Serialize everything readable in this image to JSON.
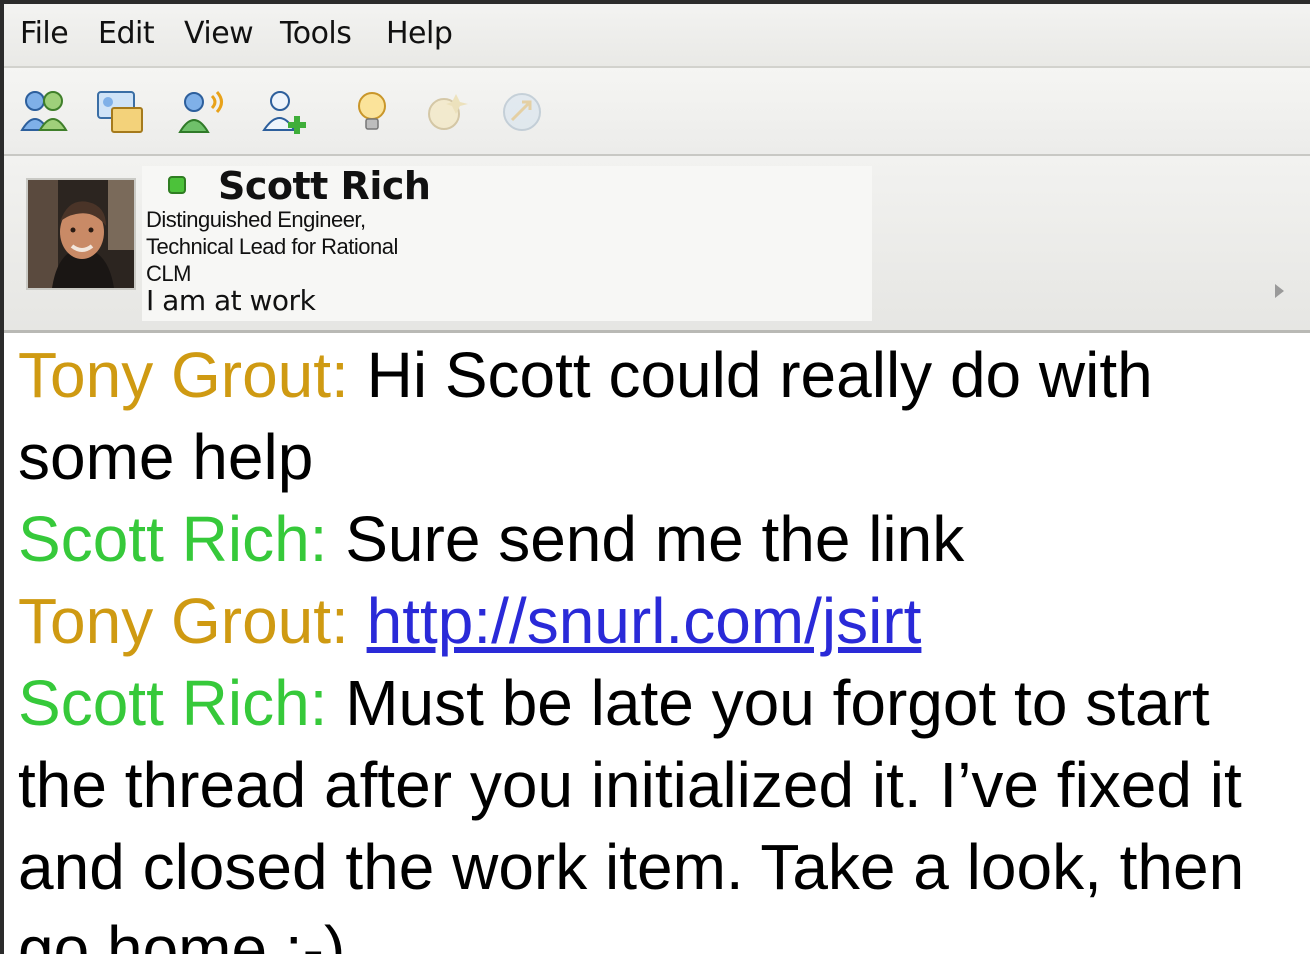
{
  "menubar": {
    "items": [
      "File",
      "Edit",
      "View",
      "Tools",
      "Help"
    ]
  },
  "toolbar": {
    "icons": [
      {
        "name": "contacts-icon"
      },
      {
        "name": "meeting-icon"
      },
      {
        "name": "call-icon"
      },
      {
        "name": "add-contact-icon"
      },
      {
        "name": "idea-icon"
      },
      {
        "name": "emoticon-icon"
      },
      {
        "name": "send-file-icon"
      }
    ]
  },
  "contact": {
    "name": "Scott Rich",
    "title": "Distinguished Engineer, Technical Lead for Rational CLM",
    "status": "I am at work",
    "presence_color": "#4cc23a"
  },
  "colors": {
    "tony": "#cf9a12",
    "scott": "#36c93a",
    "link": "#2a2ad8"
  },
  "transcript": {
    "messages": [
      {
        "sender": "Tony Grout:",
        "text": "Hi Scott could really do with some help"
      },
      {
        "sender": "Scott Rich:",
        "text": "Sure send me the link"
      },
      {
        "sender": "Tony Grout:",
        "text": "http://snurl.com/jsirt"
      },
      {
        "sender": "Scott Rich:",
        "text": "Must be late you forgot to start the thread after you initialized it. I’ve fixed it and closed the work item. Take a look, then go home :-)"
      }
    ]
  }
}
